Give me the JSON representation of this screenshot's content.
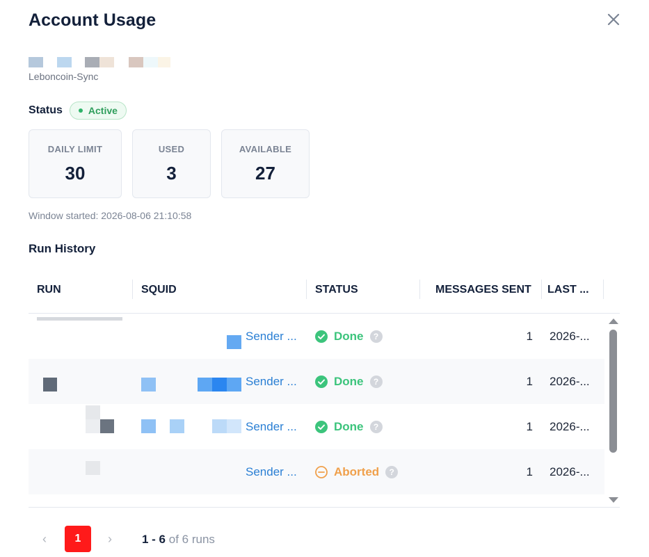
{
  "dialog": {
    "title": "Account Usage",
    "account_name": "Leboncoin-Sync",
    "status_label": "Status",
    "status_badge": "Active",
    "window_started": "Window started: 2026-08-06 21:10:58",
    "section_title": "Run History"
  },
  "stats": [
    {
      "label": "DAILY LIMIT",
      "value": "30"
    },
    {
      "label": "USED",
      "value": "3"
    },
    {
      "label": "AVAILABLE",
      "value": "27"
    }
  ],
  "table": {
    "columns": [
      "RUN",
      "SQUID",
      "STATUS",
      "MESSAGES SENT",
      "LAST ..."
    ],
    "rows": [
      {
        "squid": "Sender ...",
        "status": "Done",
        "messages_sent": "1",
        "last": "2026-..."
      },
      {
        "squid": "Sender ...",
        "status": "Done",
        "messages_sent": "1",
        "last": "2026-..."
      },
      {
        "squid": "Sender ...",
        "status": "Done",
        "messages_sent": "1",
        "last": "2026-..."
      },
      {
        "squid": "Sender ...",
        "status": "Aborted",
        "messages_sent": "1",
        "last": "2026-..."
      }
    ]
  },
  "pagination": {
    "current_page": "1",
    "range": "1 - 6",
    "total": "of 6 runs",
    "prev_icon": "chevron-left-icon",
    "next_icon": "chevron-right-icon"
  },
  "colors": {
    "active_green": "#2f9e5c",
    "done_green": "#3cc47c",
    "aborted_orange": "#f0a04b",
    "link_blue": "#2a7fd4",
    "page_active_red": "#ff1a1a"
  }
}
